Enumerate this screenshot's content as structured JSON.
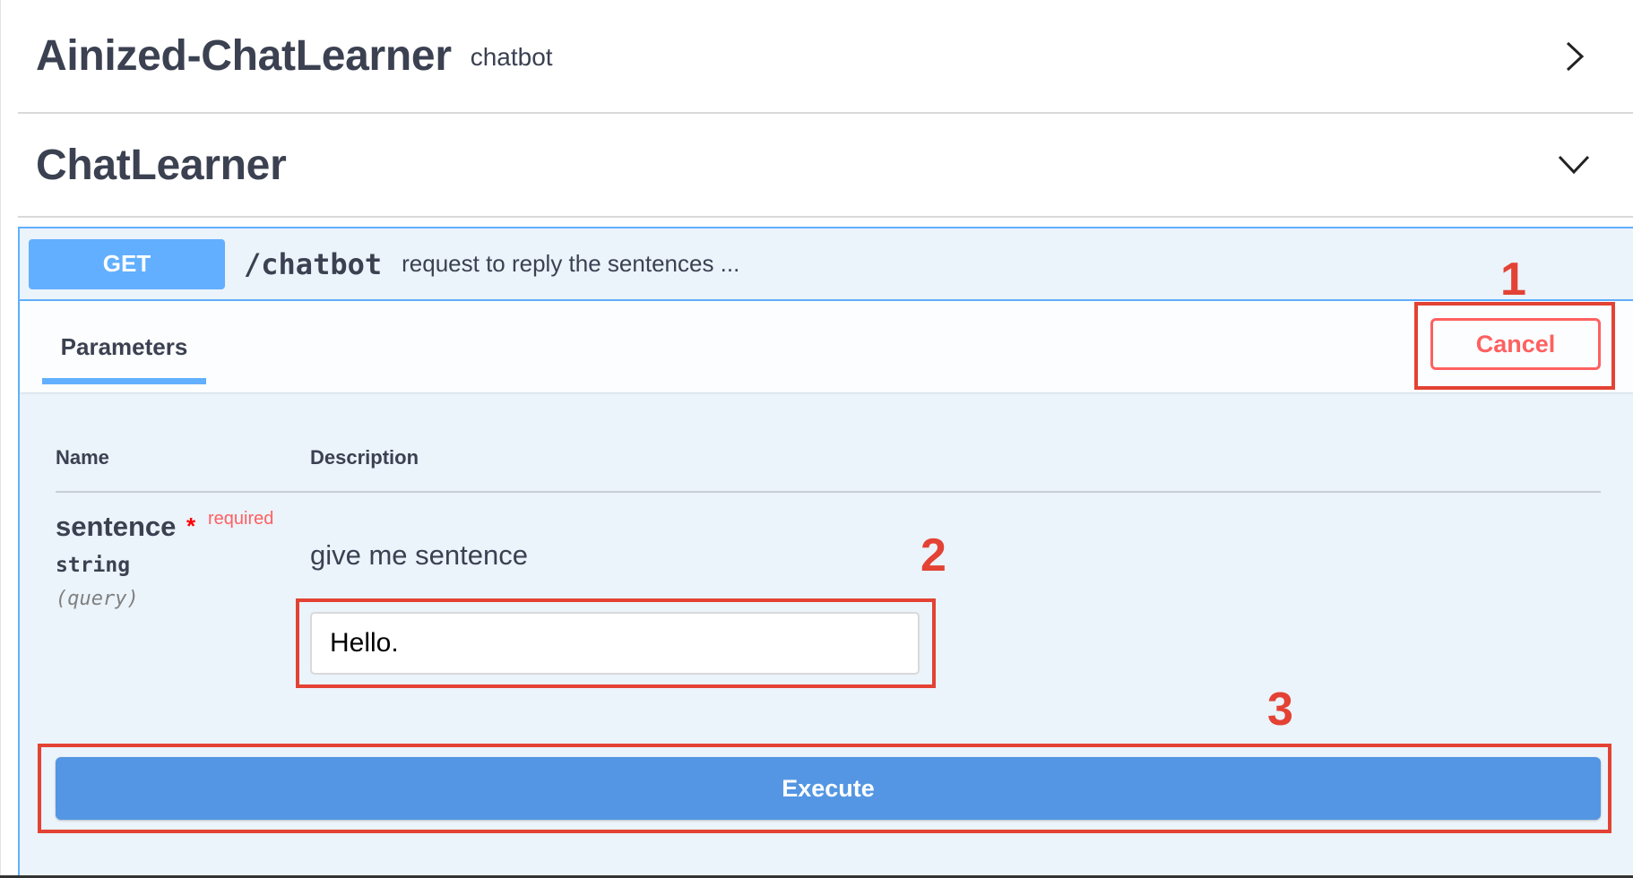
{
  "header": {
    "app_title": "Ainized-ChatLearner",
    "app_subtitle": "chatbot",
    "section_title": "ChatLearner"
  },
  "operation": {
    "method": "GET",
    "path": "/chatbot",
    "summary": "request to reply the sentences ..."
  },
  "tabs": {
    "parameters_label": "Parameters",
    "cancel_label": "Cancel"
  },
  "table": {
    "name_header": "Name",
    "description_header": "Description"
  },
  "parameter": {
    "name": "sentence",
    "required_star": "*",
    "required_label": "required",
    "type": "string",
    "location": "(query)",
    "description": "give me sentence",
    "value": "Hello."
  },
  "execute_label": "Execute",
  "annotations": {
    "one": "1",
    "two": "2",
    "three": "3"
  },
  "colors": {
    "get_blue": "#61affe",
    "execute_blue": "#4990e2",
    "cancel_red": "#ff6060",
    "annotation_red": "#e34234"
  },
  "icons": {
    "first_section_toggle": "chevron-right-icon",
    "second_section_toggle": "chevron-down-icon"
  }
}
